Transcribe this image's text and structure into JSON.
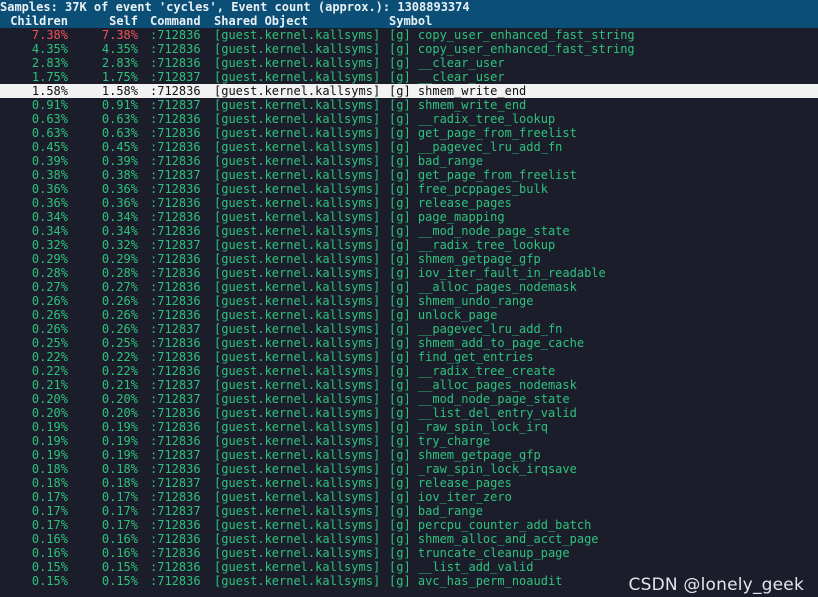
{
  "header": {
    "summary": "Samples: 37K of event 'cycles', Event count (approx.): 1308893374",
    "columns": {
      "children": "Children",
      "self": "Self",
      "command": "Command",
      "shared_object": "Shared Object",
      "symbol": "Symbol"
    }
  },
  "colors": {
    "header_bg": "#0b4f77",
    "background": "#1b1d2a",
    "text": "#2ec27e",
    "hot": "#f0545a",
    "selected_bg": "#f2f2f2"
  },
  "selected_index": 4,
  "hot_rows": [
    0
  ],
  "rows": [
    {
      "children": "7.38%",
      "self": "7.38%",
      "command": ":712836",
      "shared_object": "[guest.kernel.kallsyms]",
      "symbol": "[g] copy_user_enhanced_fast_string"
    },
    {
      "children": "4.35%",
      "self": "4.35%",
      "command": ":712836",
      "shared_object": "[guest.kernel.kallsyms]",
      "symbol": "[g] copy_user_enhanced_fast_string"
    },
    {
      "children": "2.83%",
      "self": "2.83%",
      "command": ":712836",
      "shared_object": "[guest.kernel.kallsyms]",
      "symbol": "[g] __clear_user"
    },
    {
      "children": "1.75%",
      "self": "1.75%",
      "command": ":712837",
      "shared_object": "[guest.kernel.kallsyms]",
      "symbol": "[g] __clear_user"
    },
    {
      "children": "1.58%",
      "self": "1.58%",
      "command": ":712836",
      "shared_object": "[guest.kernel.kallsyms]",
      "symbol": "[g] shmem_write_end"
    },
    {
      "children": "0.91%",
      "self": "0.91%",
      "command": ":712837",
      "shared_object": "[guest.kernel.kallsyms]",
      "symbol": "[g] shmem_write_end"
    },
    {
      "children": "0.63%",
      "self": "0.63%",
      "command": ":712836",
      "shared_object": "[guest.kernel.kallsyms]",
      "symbol": "[g] __radix_tree_lookup"
    },
    {
      "children": "0.63%",
      "self": "0.63%",
      "command": ":712836",
      "shared_object": "[guest.kernel.kallsyms]",
      "symbol": "[g] get_page_from_freelist"
    },
    {
      "children": "0.45%",
      "self": "0.45%",
      "command": ":712836",
      "shared_object": "[guest.kernel.kallsyms]",
      "symbol": "[g] __pagevec_lru_add_fn"
    },
    {
      "children": "0.39%",
      "self": "0.39%",
      "command": ":712836",
      "shared_object": "[guest.kernel.kallsyms]",
      "symbol": "[g] bad_range"
    },
    {
      "children": "0.38%",
      "self": "0.38%",
      "command": ":712837",
      "shared_object": "[guest.kernel.kallsyms]",
      "symbol": "[g] get_page_from_freelist"
    },
    {
      "children": "0.36%",
      "self": "0.36%",
      "command": ":712836",
      "shared_object": "[guest.kernel.kallsyms]",
      "symbol": "[g] free_pcppages_bulk"
    },
    {
      "children": "0.36%",
      "self": "0.36%",
      "command": ":712836",
      "shared_object": "[guest.kernel.kallsyms]",
      "symbol": "[g] release_pages"
    },
    {
      "children": "0.34%",
      "self": "0.34%",
      "command": ":712836",
      "shared_object": "[guest.kernel.kallsyms]",
      "symbol": "[g] page_mapping"
    },
    {
      "children": "0.34%",
      "self": "0.34%",
      "command": ":712836",
      "shared_object": "[guest.kernel.kallsyms]",
      "symbol": "[g] __mod_node_page_state"
    },
    {
      "children": "0.32%",
      "self": "0.32%",
      "command": ":712837",
      "shared_object": "[guest.kernel.kallsyms]",
      "symbol": "[g] __radix_tree_lookup"
    },
    {
      "children": "0.29%",
      "self": "0.29%",
      "command": ":712836",
      "shared_object": "[guest.kernel.kallsyms]",
      "symbol": "[g] shmem_getpage_gfp"
    },
    {
      "children": "0.28%",
      "self": "0.28%",
      "command": ":712836",
      "shared_object": "[guest.kernel.kallsyms]",
      "symbol": "[g] iov_iter_fault_in_readable"
    },
    {
      "children": "0.27%",
      "self": "0.27%",
      "command": ":712836",
      "shared_object": "[guest.kernel.kallsyms]",
      "symbol": "[g] __alloc_pages_nodemask"
    },
    {
      "children": "0.26%",
      "self": "0.26%",
      "command": ":712836",
      "shared_object": "[guest.kernel.kallsyms]",
      "symbol": "[g] shmem_undo_range"
    },
    {
      "children": "0.26%",
      "self": "0.26%",
      "command": ":712836",
      "shared_object": "[guest.kernel.kallsyms]",
      "symbol": "[g] unlock_page"
    },
    {
      "children": "0.26%",
      "self": "0.26%",
      "command": ":712837",
      "shared_object": "[guest.kernel.kallsyms]",
      "symbol": "[g] __pagevec_lru_add_fn"
    },
    {
      "children": "0.25%",
      "self": "0.25%",
      "command": ":712836",
      "shared_object": "[guest.kernel.kallsyms]",
      "symbol": "[g] shmem_add_to_page_cache"
    },
    {
      "children": "0.22%",
      "self": "0.22%",
      "command": ":712836",
      "shared_object": "[guest.kernel.kallsyms]",
      "symbol": "[g] find_get_entries"
    },
    {
      "children": "0.22%",
      "self": "0.22%",
      "command": ":712836",
      "shared_object": "[guest.kernel.kallsyms]",
      "symbol": "[g] __radix_tree_create"
    },
    {
      "children": "0.21%",
      "self": "0.21%",
      "command": ":712837",
      "shared_object": "[guest.kernel.kallsyms]",
      "symbol": "[g] __alloc_pages_nodemask"
    },
    {
      "children": "0.20%",
      "self": "0.20%",
      "command": ":712837",
      "shared_object": "[guest.kernel.kallsyms]",
      "symbol": "[g] __mod_node_page_state"
    },
    {
      "children": "0.20%",
      "self": "0.20%",
      "command": ":712836",
      "shared_object": "[guest.kernel.kallsyms]",
      "symbol": "[g] __list_del_entry_valid"
    },
    {
      "children": "0.19%",
      "self": "0.19%",
      "command": ":712836",
      "shared_object": "[guest.kernel.kallsyms]",
      "symbol": "[g] _raw_spin_lock_irq"
    },
    {
      "children": "0.19%",
      "self": "0.19%",
      "command": ":712836",
      "shared_object": "[guest.kernel.kallsyms]",
      "symbol": "[g] try_charge"
    },
    {
      "children": "0.19%",
      "self": "0.19%",
      "command": ":712837",
      "shared_object": "[guest.kernel.kallsyms]",
      "symbol": "[g] shmem_getpage_gfp"
    },
    {
      "children": "0.18%",
      "self": "0.18%",
      "command": ":712836",
      "shared_object": "[guest.kernel.kallsyms]",
      "symbol": "[g] _raw_spin_lock_irqsave"
    },
    {
      "children": "0.18%",
      "self": "0.18%",
      "command": ":712837",
      "shared_object": "[guest.kernel.kallsyms]",
      "symbol": "[g] release_pages"
    },
    {
      "children": "0.17%",
      "self": "0.17%",
      "command": ":712836",
      "shared_object": "[guest.kernel.kallsyms]",
      "symbol": "[g] iov_iter_zero"
    },
    {
      "children": "0.17%",
      "self": "0.17%",
      "command": ":712837",
      "shared_object": "[guest.kernel.kallsyms]",
      "symbol": "[g] bad_range"
    },
    {
      "children": "0.17%",
      "self": "0.17%",
      "command": ":712836",
      "shared_object": "[guest.kernel.kallsyms]",
      "symbol": "[g] percpu_counter_add_batch"
    },
    {
      "children": "0.16%",
      "self": "0.16%",
      "command": ":712836",
      "shared_object": "[guest.kernel.kallsyms]",
      "symbol": "[g] shmem_alloc_and_acct_page"
    },
    {
      "children": "0.16%",
      "self": "0.16%",
      "command": ":712836",
      "shared_object": "[guest.kernel.kallsyms]",
      "symbol": "[g] truncate_cleanup_page"
    },
    {
      "children": "0.15%",
      "self": "0.15%",
      "command": ":712836",
      "shared_object": "[guest.kernel.kallsyms]",
      "symbol": "[g] __list_add_valid"
    },
    {
      "children": "0.15%",
      "self": "0.15%",
      "command": ":712836",
      "shared_object": "[guest.kernel.kallsyms]",
      "symbol": "[g] avc_has_perm_noaudit"
    }
  ],
  "watermark": "CSDN @lonely_geek"
}
